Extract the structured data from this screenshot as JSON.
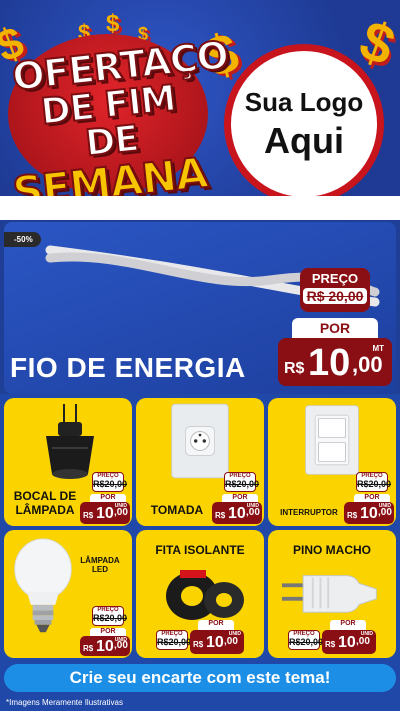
{
  "header": {
    "title_line1": "OFERTAÇO",
    "title_line2": "DE FIM DE",
    "title_line3": "SEMANA",
    "logo_line1": "Sua Logo",
    "logo_line2": "Aqui"
  },
  "hero": {
    "discount_badge": "-50%",
    "product_name": "FIO DE ENERGIA",
    "old_label": "PREÇO",
    "old_price": "R$ 20,00",
    "por_label": "POR",
    "currency": "R$",
    "price_int": "10",
    "price_cents": ",00",
    "unit": "MT",
    "colors": {
      "accent_red": "#8a0f14",
      "blue": "#1f3f96",
      "yellow": "#fbd400"
    }
  },
  "cards": [
    {
      "name": "BOCAL DE LÂMPADA",
      "old_label": "PREÇO",
      "old_price": "R$20,00",
      "por_label": "POR",
      "currency": "R$",
      "price_int": "10",
      "price_cents": ",00",
      "unit": "UNID",
      "image": "socket-icon"
    },
    {
      "name": "TOMADA",
      "old_label": "PREÇO",
      "old_price": "R$20,00",
      "por_label": "POR",
      "currency": "R$",
      "price_int": "10",
      "price_cents": ",00",
      "unit": "UNID",
      "image": "outlet-icon"
    },
    {
      "name": "INTERRUPTOR",
      "old_label": "PREÇO",
      "old_price": "R$20,00",
      "por_label": "POR",
      "currency": "R$",
      "price_int": "10",
      "price_cents": ",00",
      "unit": "UNID",
      "image": "switch-icon"
    },
    {
      "name": "LÂMPADA LED",
      "old_label": "PREÇO",
      "old_price": "R$20,00",
      "por_label": "POR",
      "currency": "R$",
      "price_int": "10",
      "price_cents": ",00",
      "unit": "UNID",
      "image": "bulb-icon"
    },
    {
      "name": "FITA ISOLANTE",
      "old_label": "PREÇO",
      "old_price": "R$20,00",
      "por_label": "POR",
      "currency": "R$",
      "price_int": "10",
      "price_cents": ",00",
      "unit": "UNID",
      "image": "tape-icon"
    },
    {
      "name": "PINO MACHO",
      "old_label": "PREÇO",
      "old_price": "R$20,00",
      "por_label": "POR",
      "currency": "R$",
      "price_int": "10",
      "price_cents": ",00",
      "unit": "UNID",
      "image": "plug-icon"
    }
  ],
  "footer": {
    "cta": "Crie seu encarte com este tema!",
    "note": "*Imagens Meramente Ilustrativas"
  }
}
